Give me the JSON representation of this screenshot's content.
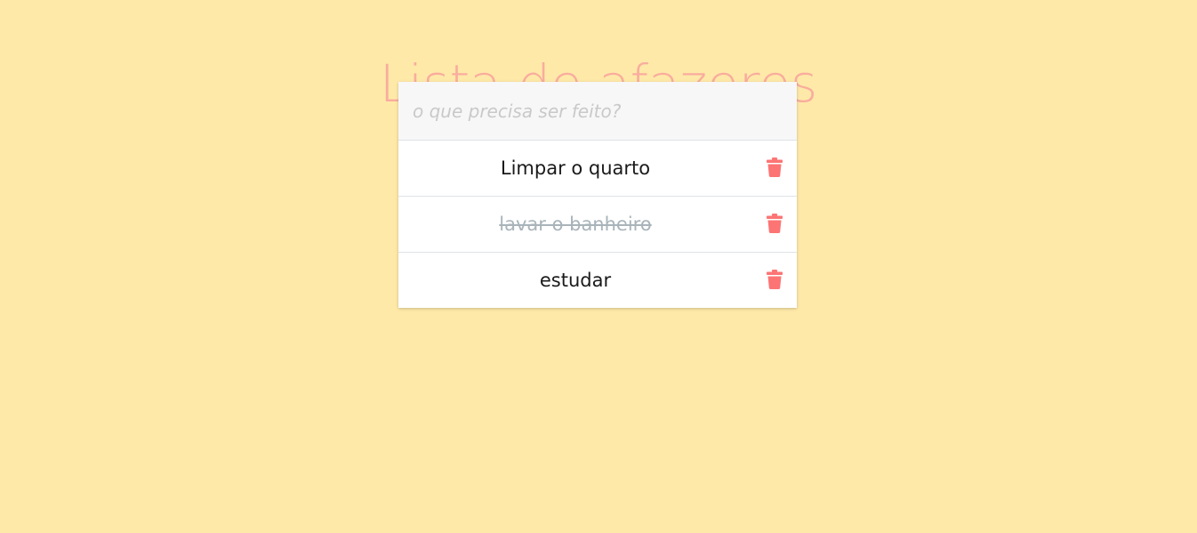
{
  "title": "Lista de afazeres",
  "input": {
    "placeholder": "o que precisa ser feito?",
    "value": ""
  },
  "todos": [
    {
      "text": "Limpar o quarto",
      "done": false
    },
    {
      "text": "lavar o banheiro",
      "done": true
    },
    {
      "text": "estudar",
      "done": false
    }
  ],
  "icons": {
    "delete": "trash-icon"
  },
  "colors": {
    "background": "#ffe9a8",
    "title": "#f9ad9e",
    "trash": "#fd7474",
    "done_text": "#a9b4ba"
  }
}
